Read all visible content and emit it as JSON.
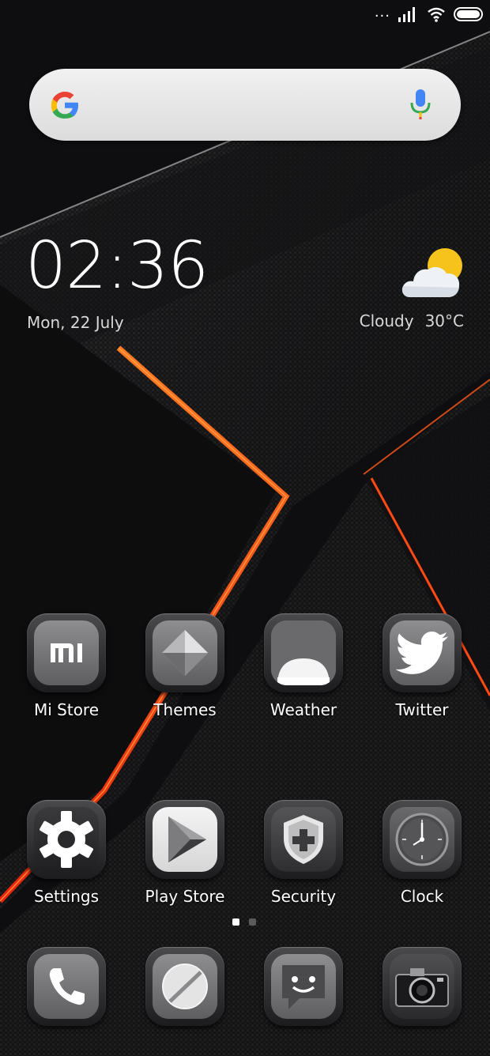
{
  "status_bar": {
    "dots": "...",
    "signal_icon": "signal-bars-icon",
    "wifi_icon": "wifi-icon",
    "battery_icon": "battery-icon"
  },
  "search_widget": {
    "logo_icon": "google-g-icon",
    "mic_icon": "microphone-icon"
  },
  "clock_widget": {
    "time": "02:36",
    "date": "Mon, 22 July"
  },
  "weather_widget": {
    "icon": "partly-cloudy-icon",
    "condition": "Cloudy",
    "temperature": "30°C"
  },
  "apps_row1": [
    {
      "label": "Mi Store",
      "icon": "mi-logo-icon"
    },
    {
      "label": "Themes",
      "icon": "themes-diamond-icon"
    },
    {
      "label": "Weather",
      "icon": "weather-sun-icon"
    },
    {
      "label": "Twitter",
      "icon": "twitter-bird-icon"
    }
  ],
  "apps_row2": [
    {
      "label": "Settings",
      "icon": "gear-icon"
    },
    {
      "label": "Play Store",
      "icon": "play-triangle-icon"
    },
    {
      "label": "Security",
      "icon": "shield-plus-icon"
    },
    {
      "label": "Clock",
      "icon": "clock-face-icon"
    }
  ],
  "page_indicator": {
    "pages": 2,
    "current": 1
  },
  "dock": [
    {
      "icon": "phone-icon"
    },
    {
      "icon": "browser-icon"
    },
    {
      "icon": "messages-icon"
    },
    {
      "icon": "camera-icon"
    }
  ],
  "colors": {
    "accent_orange": "#ff4a12",
    "wallpaper_dark": "#0d0d0f",
    "carbon": "#2a2a2c"
  }
}
